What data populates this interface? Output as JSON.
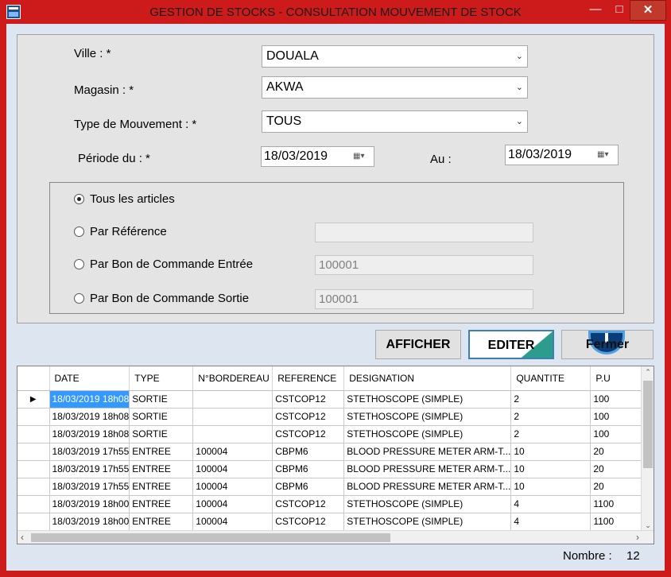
{
  "window": {
    "title": "GESTION DE STOCKS - CONSULTATION MOUVEMENT DE STOCK",
    "min_glyph": "—",
    "max_glyph": "□",
    "close_glyph": "✕"
  },
  "form": {
    "ville_label": "Ville : *",
    "ville_value": "DOUALA",
    "magasin_label": "Magasin : *",
    "magasin_value": "AKWA",
    "type_label": "Type de Mouvement : *",
    "type_value": "TOUS",
    "periode_label": "Période du  : *",
    "date_from": "18/03/2019",
    "au_label": "Au  :",
    "date_to": "18/03/2019"
  },
  "options": {
    "tous_label": "Tous les articles",
    "reference_label": "Par Référence",
    "reference_value": "",
    "bc_entree_label": "Par Bon de Commande Entrée",
    "bc_entree_value": "100001",
    "bc_sortie_label": "Par Bon de Commande Sortie",
    "bc_sortie_value": "100001",
    "selected": "tous"
  },
  "buttons": {
    "afficher": "AFFICHER",
    "editer": "EDITER",
    "fermer": "Fermer"
  },
  "table": {
    "columns": [
      "DATE",
      "TYPE",
      "N°BORDEREAU",
      "REFERENCE",
      "DESIGNATION",
      "QUANTITE",
      "P.U"
    ],
    "rows": [
      [
        "18/03/2019 18h08",
        "SORTIE",
        "",
        "CSTCOP12",
        "STETHOSCOPE (SIMPLE)",
        "2",
        "100"
      ],
      [
        "18/03/2019 18h08",
        "SORTIE",
        "",
        "CSTCOP12",
        "STETHOSCOPE (SIMPLE)",
        "2",
        "100"
      ],
      [
        "18/03/2019 18h08",
        "SORTIE",
        "",
        "CSTCOP12",
        "STETHOSCOPE (SIMPLE)",
        "2",
        "100"
      ],
      [
        "18/03/2019 17h55",
        "ENTREE",
        "100004",
        "CBPM6",
        "BLOOD PRESSURE METER ARM-T...",
        "10",
        "20"
      ],
      [
        "18/03/2019 17h55",
        "ENTREE",
        "100004",
        "CBPM6",
        "BLOOD PRESSURE METER ARM-T...",
        "10",
        "20"
      ],
      [
        "18/03/2019 17h55",
        "ENTREE",
        "100004",
        "CBPM6",
        "BLOOD PRESSURE METER ARM-T...",
        "10",
        "20"
      ],
      [
        "18/03/2019 18h00",
        "ENTREE",
        "100004",
        "CSTCOP12",
        "STETHOSCOPE (SIMPLE)",
        "4",
        "1100"
      ],
      [
        "18/03/2019 18h00",
        "ENTREE",
        "100004",
        "CSTCOP12",
        "STETHOSCOPE (SIMPLE)",
        "4",
        "1100"
      ]
    ],
    "current_row_marker": "▶"
  },
  "footer": {
    "count_label": "Nombre :",
    "count_value": "12"
  }
}
